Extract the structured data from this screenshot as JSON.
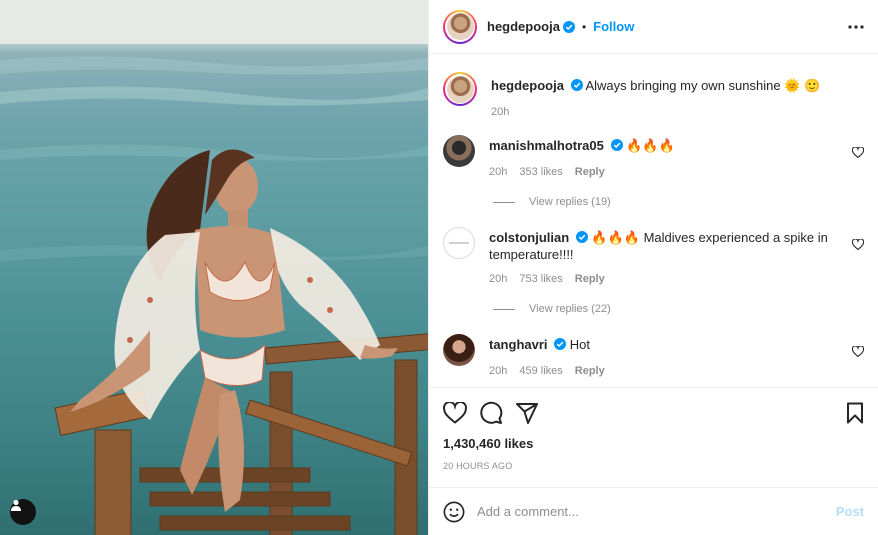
{
  "post": {
    "username": "hegdepooja",
    "separator": "•",
    "follow_label": "Follow",
    "caption": "Always bringing my own sunshine 🌞 🙂",
    "caption_time": "20h",
    "likes": "1,430,460 likes",
    "posted_ago": "20 HOURS AGO"
  },
  "comments": [
    {
      "username": "manishmalhotra05",
      "text": "🔥🔥🔥",
      "time": "20h",
      "likes": "353 likes",
      "reply_label": "Reply",
      "view_replies": "View replies (19)"
    },
    {
      "username": "colstonjulian",
      "text": "🔥🔥🔥 Maldives experienced a spike in temperature!!!!",
      "time": "20h",
      "likes": "753 likes",
      "reply_label": "Reply",
      "view_replies": "View replies (22)"
    },
    {
      "username": "tanghavri",
      "text": "Hot",
      "time": "20h",
      "likes": "459 likes",
      "reply_label": "Reply"
    }
  ],
  "add_comment": {
    "placeholder": "Add a comment...",
    "post_label": "Post"
  },
  "icons": {
    "like": "heart-icon",
    "comment": "comment-icon",
    "share": "send-icon",
    "save": "bookmark-icon",
    "more": "more-horizontal-icon",
    "emoji": "emoji-icon",
    "verified": "verified-badge-icon",
    "tag": "user-tag-icon"
  },
  "colors": {
    "accent": "#0095f6",
    "post_disabled": "#b2dffc",
    "muted": "#8e8e8e"
  }
}
